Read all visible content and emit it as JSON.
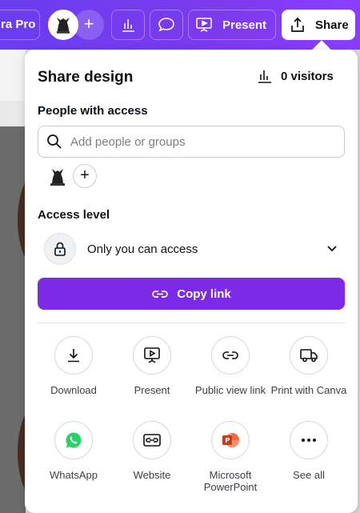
{
  "toolbar": {
    "pro_label": "ra Pro",
    "add_label": "+",
    "present_label": "Present",
    "share_label": "Share"
  },
  "panel": {
    "title": "Share design",
    "visitors": "0 visitors",
    "people_label": "People with access",
    "search_placeholder": "Add people or groups",
    "add_person": "+",
    "access_label": "Access level",
    "access_value": "Only you can access",
    "copy_link": "Copy link"
  },
  "options": [
    {
      "label": "Download",
      "icon": "download-icon"
    },
    {
      "label": "Present",
      "icon": "present-icon"
    },
    {
      "label": "Public view link",
      "icon": "link-icon"
    },
    {
      "label": "Print with Canva",
      "icon": "truck-icon"
    },
    {
      "label": "WhatsApp",
      "icon": "whatsapp-icon"
    },
    {
      "label": "Website",
      "icon": "website-icon"
    },
    {
      "label": "Microsoft PowerPoint",
      "icon": "powerpoint-icon"
    },
    {
      "label": "See all",
      "icon": "more-icon"
    }
  ],
  "colors": {
    "accent": "#7d2ae8",
    "toolbar": "#7c3aed",
    "whatsapp": "#25d366",
    "powerpoint": "#d24726"
  }
}
